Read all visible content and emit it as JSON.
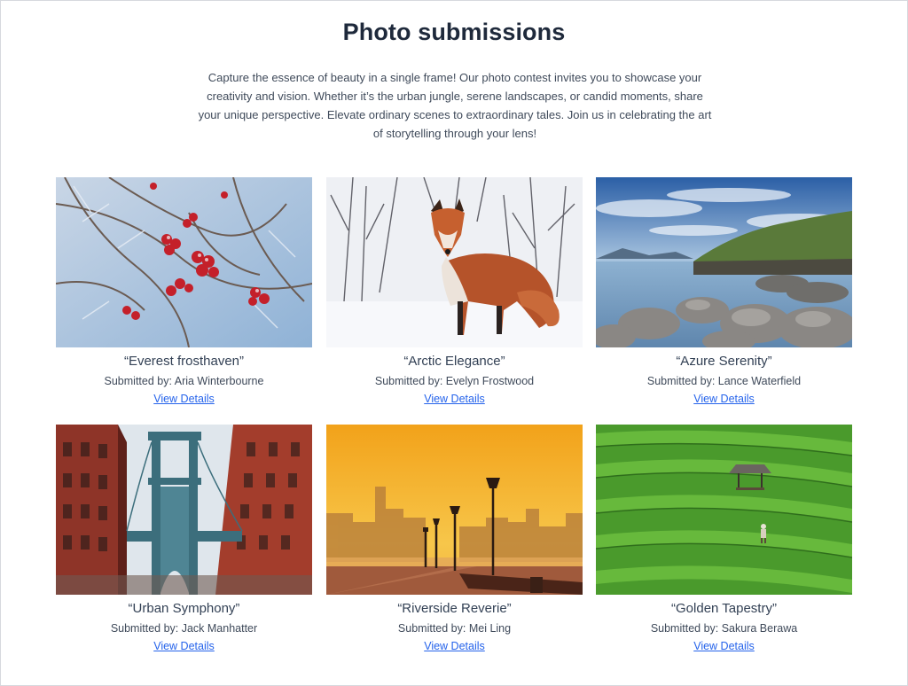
{
  "page": {
    "title": "Photo submissions",
    "intro": "Capture the essence of beauty in a single frame! Our photo contest invites you to showcase your creativity and vision. Whether it’s the urban jungle, serene landscapes, or candid moments, share your unique perspective. Elevate ordinary scenes to extraordinary tales. Join us in celebrating the art of storytelling through your lens!"
  },
  "submissions": [
    {
      "title": "“Everest frosthaven”",
      "submitted_by": "Submitted by: Aria Winterbourne",
      "link": "View Details",
      "image": "frosted-berries-photo"
    },
    {
      "title": "“Arctic Elegance”",
      "submitted_by": "Submitted by: Evelyn Frostwood",
      "link": "View Details",
      "image": "red-fox-in-snow-photo"
    },
    {
      "title": "“Azure Serenity”",
      "submitted_by": "Submitted by: Lance Waterfield",
      "link": "View Details",
      "image": "rocky-coast-photo"
    },
    {
      "title": "“Urban Symphony”",
      "submitted_by": "Submitted by: Jack Manhatter",
      "link": "View Details",
      "image": "bridge-between-buildings-photo"
    },
    {
      "title": "“Riverside Reverie”",
      "submitted_by": "Submitted by: Mei Ling",
      "link": "View Details",
      "image": "sunset-riverside-promenade-photo"
    },
    {
      "title": "“Golden Tapestry”",
      "submitted_by": "Submitted by: Sakura Berawa",
      "link": "View Details",
      "image": "rice-terraces-photo"
    }
  ],
  "colors": {
    "heading": "#1e293b",
    "text": "#334155",
    "link": "#2563eb",
    "border": "#d6d9de"
  }
}
